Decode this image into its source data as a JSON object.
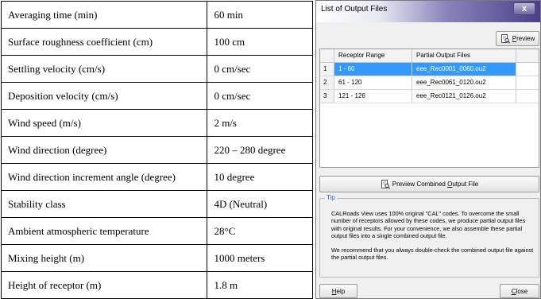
{
  "parameters": [
    {
      "name": "Averaging time (min)",
      "value": "60 min"
    },
    {
      "name": "Surface roughness coefficient (cm)",
      "value": "100 cm"
    },
    {
      "name": "Settling velocity (cm/s)",
      "value": "0 cm/sec"
    },
    {
      "name": "Deposition velocity (cm/s)",
      "value": "0 cm/sec"
    },
    {
      "name": "Wind speed (m/s)",
      "value": "2 m/s"
    },
    {
      "name": "Wind direction (degree)",
      "value": "220 – 280 degree"
    },
    {
      "name": "Wind direction increment angle (degree)",
      "value": "10 degree"
    },
    {
      "name": "Stability class",
      "value": "4D (Neutral)"
    },
    {
      "name": "Ambient atmospheric temperature",
      "value": "28°C"
    },
    {
      "name": "Mixing height (m)",
      "value": "1000 meters"
    },
    {
      "name": "Height of receptor (m)",
      "value": "1.8 m"
    }
  ],
  "dialog": {
    "title": "List of Output Files",
    "close_glyph": "x",
    "preview_button": {
      "pre": "",
      "accel": "P",
      "post": "review"
    },
    "grid": {
      "headers": [
        "Receptor Range",
        "Partial Output Files"
      ],
      "rows": [
        {
          "num": "1",
          "range": "1 - 60",
          "file": "eee_Rec0001_0060.ou2",
          "selected": true
        },
        {
          "num": "2",
          "range": "61 - 120",
          "file": "eee_Rec0061_0120.ou2",
          "selected": false
        },
        {
          "num": "3",
          "range": "121 - 126",
          "file": "eee_Rec0121_0126.ou2",
          "selected": false
        }
      ]
    },
    "combined_button": {
      "pre": "Preview Combined ",
      "accel": "O",
      "post": "utput File"
    },
    "tip": {
      "label": "Tip",
      "paragraph1": "CALRoads View uses 100% original \"CAL\" codes.  To overcome the small number of receptors allowed by these codes, we produce partial output files with original results.  For your convenience, we also assemble these partial output files into a single combined output file.",
      "paragraph2": "We recommend that you always double-check the combined output file against the partial output files."
    },
    "help_button": {
      "accel": "H",
      "post": "elp"
    },
    "close_button": {
      "accel": "C",
      "post": "lose"
    }
  },
  "colors": {
    "selection": "#3399ff",
    "title_gradient_end": "#4a3f8a",
    "tip_label": "#3a5fb0"
  }
}
